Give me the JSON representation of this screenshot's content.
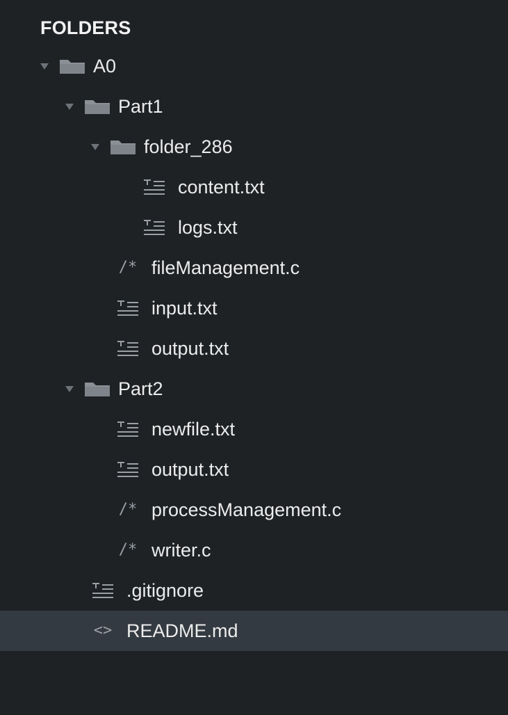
{
  "panel": {
    "title": "FOLDERS"
  },
  "tree": [
    {
      "label": "A0",
      "type": "folder",
      "depth": 0,
      "expanded": true
    },
    {
      "label": "Part1",
      "type": "folder",
      "depth": 1,
      "expanded": true
    },
    {
      "label": "folder_286",
      "type": "folder",
      "depth": 2,
      "expanded": true
    },
    {
      "label": "content.txt",
      "type": "text",
      "depth": 3
    },
    {
      "label": "logs.txt",
      "type": "text",
      "depth": 3
    },
    {
      "label": "fileManagement.c",
      "type": "c",
      "depth": 2,
      "icon_text": "/*"
    },
    {
      "label": "input.txt",
      "type": "text",
      "depth": 2
    },
    {
      "label": "output.txt",
      "type": "text",
      "depth": 2
    },
    {
      "label": "Part2",
      "type": "folder",
      "depth": 1,
      "expanded": true
    },
    {
      "label": "newfile.txt",
      "type": "text",
      "depth": 2
    },
    {
      "label": "output.txt",
      "type": "text",
      "depth": 2
    },
    {
      "label": "processManagement.c",
      "type": "c",
      "depth": 2,
      "icon_text": "/*"
    },
    {
      "label": "writer.c",
      "type": "c",
      "depth": 2,
      "icon_text": "/*"
    },
    {
      "label": ".gitignore",
      "type": "text",
      "depth": 1
    },
    {
      "label": "README.md",
      "type": "md",
      "depth": 1,
      "icon_text": "<>",
      "selected": true
    }
  ],
  "colors": {
    "background": "#1f2225",
    "selected_row": "#343a41",
    "text": "#ececec",
    "icon": "#9aa0a6",
    "folder": "#8b9096"
  }
}
